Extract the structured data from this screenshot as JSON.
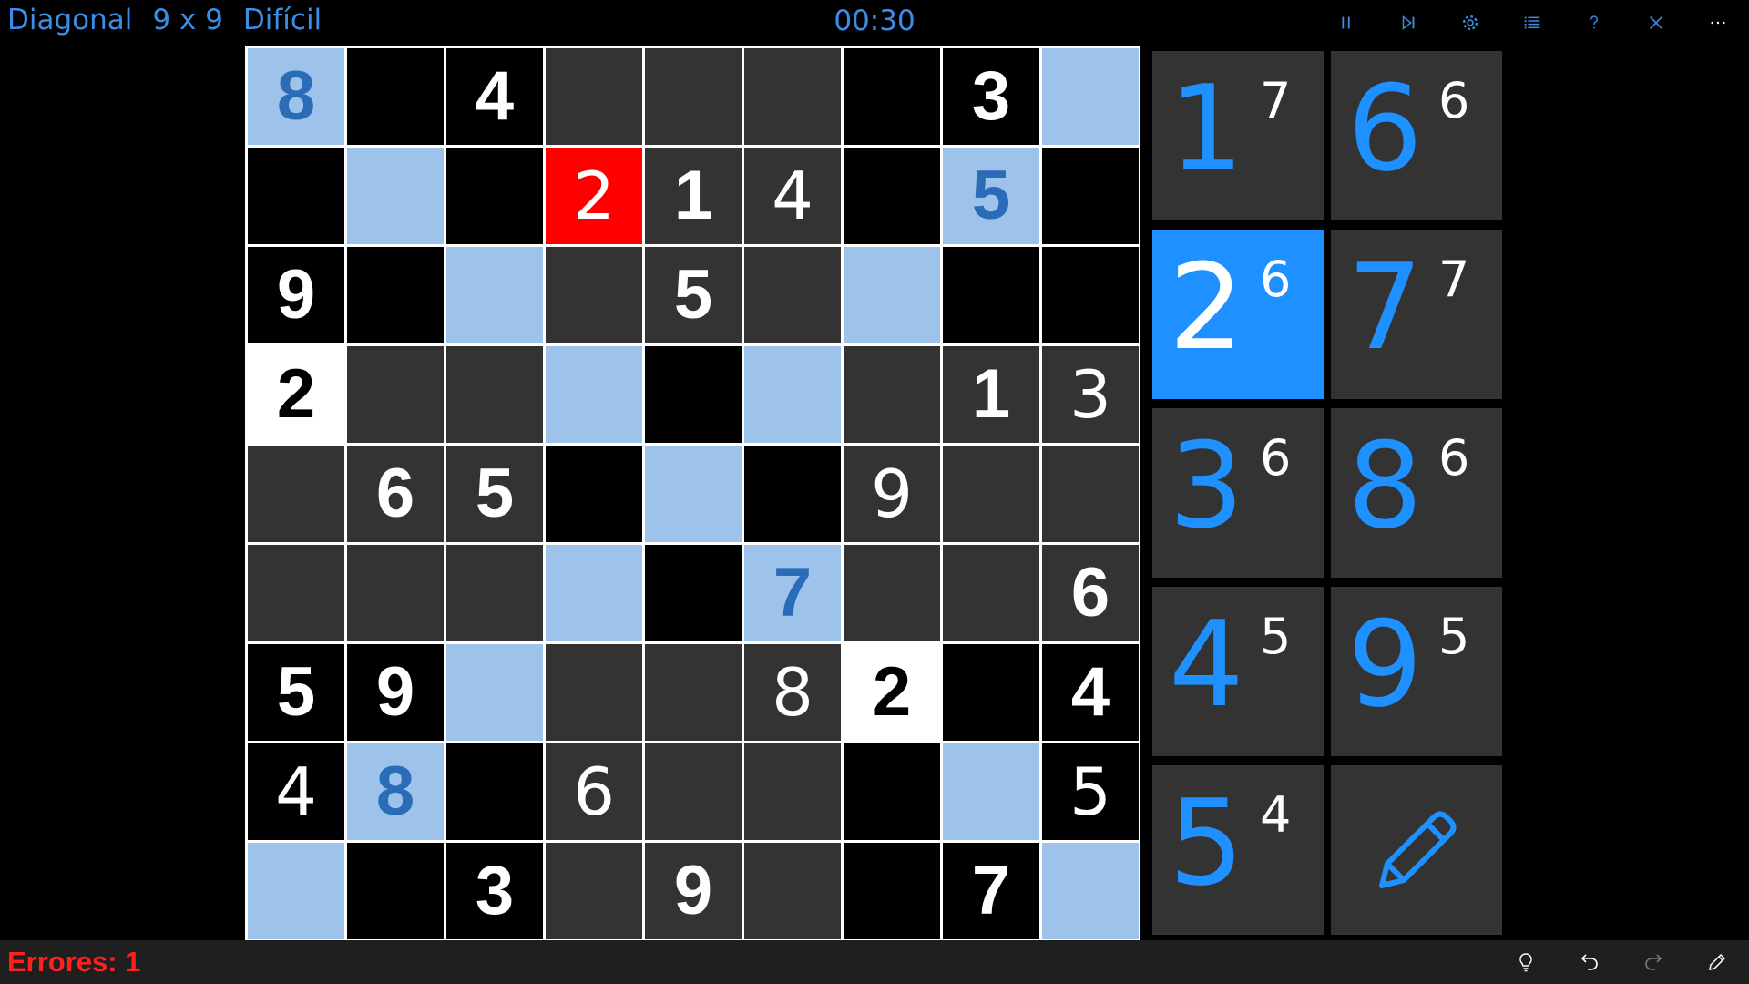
{
  "header": {
    "mode": "Diagonal",
    "size": "9 x 9",
    "difficulty": "Difícil",
    "timer": "00:30",
    "icons": [
      "pause-icon",
      "skip-next-icon",
      "settings-icon",
      "list-icon",
      "help-icon",
      "close-icon",
      "more-icon"
    ]
  },
  "board": {
    "rows": [
      [
        {
          "v": "8",
          "bg": "diag",
          "given": true
        },
        {
          "v": "",
          "bg": "black"
        },
        {
          "v": "4",
          "bg": "black",
          "given": true
        },
        {
          "v": "",
          "bg": "gray"
        },
        {
          "v": "",
          "bg": "gray"
        },
        {
          "v": "",
          "bg": "gray"
        },
        {
          "v": "",
          "bg": "black"
        },
        {
          "v": "3",
          "bg": "black",
          "given": true
        },
        {
          "v": "",
          "bg": "diag"
        }
      ],
      [
        {
          "v": "",
          "bg": "black"
        },
        {
          "v": "",
          "bg": "diag"
        },
        {
          "v": "",
          "bg": "black"
        },
        {
          "v": "2",
          "bg": "red",
          "given": false
        },
        {
          "v": "1",
          "bg": "gray",
          "given": true
        },
        {
          "v": "4",
          "bg": "gray",
          "given": false
        },
        {
          "v": "",
          "bg": "black"
        },
        {
          "v": "5",
          "bg": "diag",
          "given": true
        },
        {
          "v": "",
          "bg": "black"
        }
      ],
      [
        {
          "v": "9",
          "bg": "black",
          "given": true
        },
        {
          "v": "",
          "bg": "black"
        },
        {
          "v": "",
          "bg": "diag"
        },
        {
          "v": "",
          "bg": "gray"
        },
        {
          "v": "5",
          "bg": "gray",
          "given": true
        },
        {
          "v": "",
          "bg": "gray"
        },
        {
          "v": "",
          "bg": "diag"
        },
        {
          "v": "",
          "bg": "black"
        },
        {
          "v": "",
          "bg": "black"
        }
      ],
      [
        {
          "v": "2",
          "bg": "white",
          "given": true
        },
        {
          "v": "",
          "bg": "gray"
        },
        {
          "v": "",
          "bg": "gray"
        },
        {
          "v": "",
          "bg": "diag"
        },
        {
          "v": "",
          "bg": "black"
        },
        {
          "v": "",
          "bg": "diag"
        },
        {
          "v": "",
          "bg": "gray"
        },
        {
          "v": "1",
          "bg": "gray",
          "given": true
        },
        {
          "v": "3",
          "bg": "gray",
          "given": false
        }
      ],
      [
        {
          "v": "",
          "bg": "gray"
        },
        {
          "v": "6",
          "bg": "gray",
          "given": true
        },
        {
          "v": "5",
          "bg": "gray",
          "given": true
        },
        {
          "v": "",
          "bg": "black"
        },
        {
          "v": "",
          "bg": "diag"
        },
        {
          "v": "",
          "bg": "black"
        },
        {
          "v": "9",
          "bg": "gray",
          "given": false
        },
        {
          "v": "",
          "bg": "gray"
        },
        {
          "v": "",
          "bg": "gray"
        }
      ],
      [
        {
          "v": "",
          "bg": "gray"
        },
        {
          "v": "",
          "bg": "gray"
        },
        {
          "v": "",
          "bg": "gray"
        },
        {
          "v": "",
          "bg": "diag"
        },
        {
          "v": "",
          "bg": "black"
        },
        {
          "v": "7",
          "bg": "diag",
          "given": true
        },
        {
          "v": "",
          "bg": "gray"
        },
        {
          "v": "",
          "bg": "gray"
        },
        {
          "v": "6",
          "bg": "gray",
          "given": true
        }
      ],
      [
        {
          "v": "5",
          "bg": "black",
          "given": true
        },
        {
          "v": "9",
          "bg": "black",
          "given": true
        },
        {
          "v": "",
          "bg": "diag"
        },
        {
          "v": "",
          "bg": "gray"
        },
        {
          "v": "",
          "bg": "gray"
        },
        {
          "v": "8",
          "bg": "gray",
          "given": false
        },
        {
          "v": "2",
          "bg": "white",
          "given": true
        },
        {
          "v": "",
          "bg": "black"
        },
        {
          "v": "4",
          "bg": "black",
          "given": true
        }
      ],
      [
        {
          "v": "4",
          "bg": "black",
          "given": false
        },
        {
          "v": "8",
          "bg": "diag",
          "given": true
        },
        {
          "v": "",
          "bg": "black"
        },
        {
          "v": "6",
          "bg": "gray",
          "given": false
        },
        {
          "v": "",
          "bg": "gray"
        },
        {
          "v": "",
          "bg": "gray"
        },
        {
          "v": "",
          "bg": "black"
        },
        {
          "v": "",
          "bg": "diag"
        },
        {
          "v": "5",
          "bg": "black",
          "given": false
        }
      ],
      [
        {
          "v": "",
          "bg": "diag"
        },
        {
          "v": "",
          "bg": "black"
        },
        {
          "v": "3",
          "bg": "black",
          "given": true
        },
        {
          "v": "",
          "bg": "gray"
        },
        {
          "v": "9",
          "bg": "gray",
          "given": true
        },
        {
          "v": "",
          "bg": "gray"
        },
        {
          "v": "",
          "bg": "black"
        },
        {
          "v": "7",
          "bg": "black",
          "given": true
        },
        {
          "v": "",
          "bg": "diag"
        }
      ]
    ]
  },
  "numpad": [
    {
      "digit": "1",
      "remaining": "7",
      "selected": false
    },
    {
      "digit": "6",
      "remaining": "6",
      "selected": false
    },
    {
      "digit": "2",
      "remaining": "6",
      "selected": true
    },
    {
      "digit": "7",
      "remaining": "7",
      "selected": false
    },
    {
      "digit": "3",
      "remaining": "6",
      "selected": false
    },
    {
      "digit": "8",
      "remaining": "6",
      "selected": false
    },
    {
      "digit": "4",
      "remaining": "5",
      "selected": false
    },
    {
      "digit": "9",
      "remaining": "5",
      "selected": false
    },
    {
      "digit": "5",
      "remaining": "4",
      "selected": false
    }
  ],
  "footer": {
    "errors": "Errores: 1",
    "icons": [
      "hint-icon",
      "undo-icon",
      "redo-icon",
      "edit-icon"
    ]
  },
  "colors": {
    "accent": "#1e90ff",
    "header_text": "#3a8ee6",
    "error": "#ff2020",
    "diagonal_cell": "#9dc3ea",
    "conflict_cell": "#ff0000",
    "cell_gray": "#333333"
  }
}
